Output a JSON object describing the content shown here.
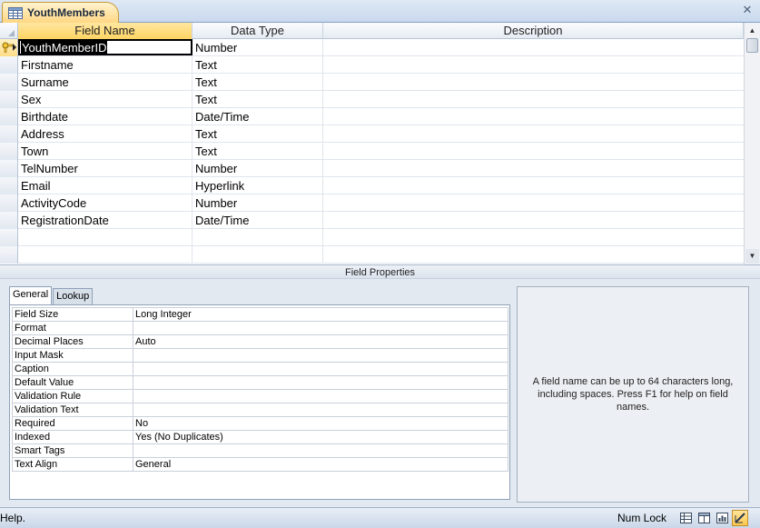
{
  "document_tab": {
    "title": "YouthMembers",
    "icon": "table-icon"
  },
  "grid": {
    "headers": {
      "field_name": "Field Name",
      "data_type": "Data Type",
      "description": "Description"
    },
    "rows": [
      {
        "field": "YouthMemberID",
        "type": "Number",
        "desc": "",
        "primary_key": true
      },
      {
        "field": "Firstname",
        "type": "Text",
        "desc": ""
      },
      {
        "field": "Surname",
        "type": "Text",
        "desc": ""
      },
      {
        "field": "Sex",
        "type": "Text",
        "desc": ""
      },
      {
        "field": "Birthdate",
        "type": "Date/Time",
        "desc": ""
      },
      {
        "field": "Address",
        "type": "Text",
        "desc": ""
      },
      {
        "field": "Town",
        "type": "Text",
        "desc": ""
      },
      {
        "field": "TelNumber",
        "type": "Number",
        "desc": ""
      },
      {
        "field": "Email",
        "type": "Hyperlink",
        "desc": ""
      },
      {
        "field": "ActivityCode",
        "type": "Number",
        "desc": ""
      },
      {
        "field": "RegistrationDate",
        "type": "Date/Time",
        "desc": ""
      }
    ]
  },
  "field_properties": {
    "caption": "Field Properties",
    "tabs": [
      "General",
      "Lookup"
    ],
    "properties": [
      {
        "label": "Field Size",
        "value": "Long Integer"
      },
      {
        "label": "Format",
        "value": ""
      },
      {
        "label": "Decimal Places",
        "value": "Auto"
      },
      {
        "label": "Input Mask",
        "value": ""
      },
      {
        "label": "Caption",
        "value": ""
      },
      {
        "label": "Default Value",
        "value": ""
      },
      {
        "label": "Validation Rule",
        "value": ""
      },
      {
        "label": "Validation Text",
        "value": ""
      },
      {
        "label": "Required",
        "value": "No"
      },
      {
        "label": "Indexed",
        "value": "Yes (No Duplicates)"
      },
      {
        "label": "Smart Tags",
        "value": ""
      },
      {
        "label": "Text Align",
        "value": "General"
      }
    ],
    "help_text": "A field name can be up to 64 characters long, including spaces. Press F1 for help on field names."
  },
  "status_bar": {
    "message": "Help.",
    "num_lock": "Num Lock"
  },
  "colors": {
    "accent": "#ffd563",
    "tab_border": "#c59a3a",
    "chrome": "#dbe3ee"
  }
}
